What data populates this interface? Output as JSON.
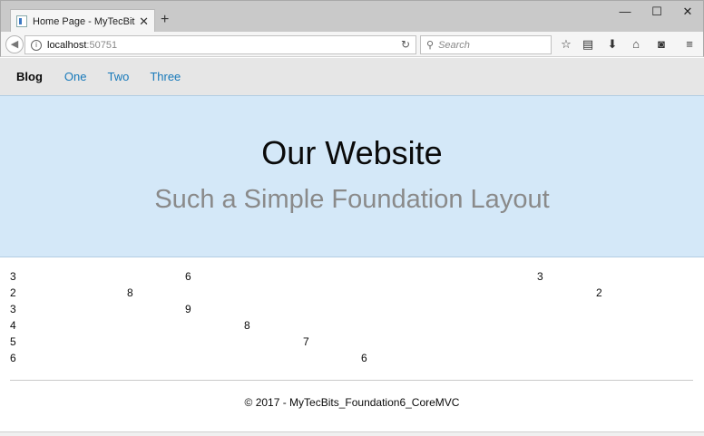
{
  "browser": {
    "tab_title": "Home Page - MyTecBits_Fo",
    "new_tab": "+",
    "url_host": "localhost",
    "url_port": ":50751",
    "search_placeholder": "Search"
  },
  "nav": {
    "brand": "Blog",
    "links": [
      "One",
      "Two",
      "Three"
    ]
  },
  "hero": {
    "title": "Our Website",
    "subtitle": "Such a Simple Foundation Layout"
  },
  "grid_rows": [
    [
      "3",
      "6",
      "3"
    ],
    [
      "2",
      "8",
      "2"
    ],
    [
      "3",
      "9"
    ],
    [
      "4",
      "8"
    ],
    [
      "5",
      "7"
    ],
    [
      "6",
      "6"
    ]
  ],
  "footer": {
    "text": "© 2017 - MyTecBits_Foundation6_CoreMVC"
  }
}
